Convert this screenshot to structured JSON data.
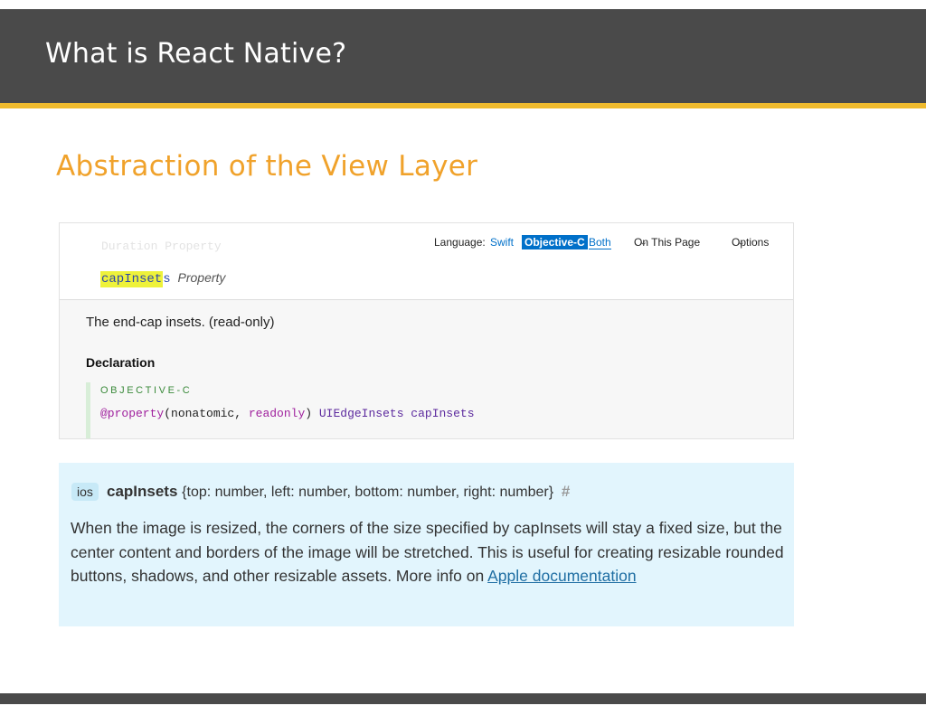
{
  "slide": {
    "title": "What is React Native?",
    "subtitle": "Abstraction of the View Layer",
    "colors": {
      "header_bg": "#4a4a4a",
      "accent": "#f0bb2e",
      "subtitle": "#f0a22b"
    }
  },
  "apple_doc": {
    "ghost_text": "Duration Property",
    "property_name_highlighted": "capInset",
    "property_name_tail": "s",
    "property_kind": "Property",
    "language_label": "Language:",
    "languages": [
      "Swift",
      "Objective-C",
      "Both"
    ],
    "selected_language": "Objective-C",
    "on_this_page": "On This Page",
    "options": "Options",
    "summary": "The end-cap insets. (read-only)",
    "declaration_heading": "Declaration",
    "code_language": "OBJECTIVE-C",
    "code": {
      "keyword": "@property",
      "args_open": "(nonatomic, ",
      "readonly": "readonly",
      "args_close": ") ",
      "type": "UIEdgeInsets capInsets"
    }
  },
  "rn_doc": {
    "platform_badge": "ios",
    "prop_name": "capInsets",
    "prop_signature": "{top: number, left: number, bottom: number, right: number}",
    "anchor": "#",
    "description": "When the image is resized, the corners of the size specified by capInsets will stay a fixed size, but the center content and borders of the image will be stretched. This is useful for creating resizable rounded buttons, shadows, and other resizable assets. More info on",
    "link_text": "Apple documentation"
  }
}
